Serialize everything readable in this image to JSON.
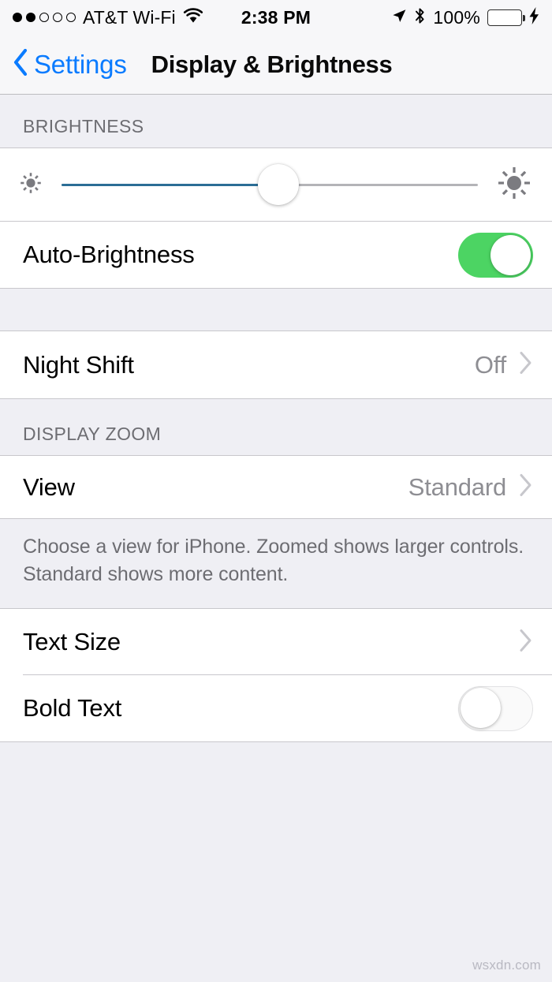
{
  "status_bar": {
    "signal_dots_filled": 2,
    "signal_dots_total": 5,
    "carrier": "AT&T Wi-Fi",
    "wifi_icon": "wifi-icon",
    "time": "2:38 PM",
    "location_icon": "location-arrow-icon",
    "bluetooth_icon": "bluetooth-icon",
    "battery_percent": "100%",
    "battery_level": 100,
    "charging_icon": "lightning-bolt-icon",
    "battery_color": "#4cd964"
  },
  "nav_bar": {
    "back_label": "Settings",
    "back_icon": "chevron-left-icon",
    "title": "Display & Brightness",
    "accent_color": "#0a7bff"
  },
  "sections": {
    "brightness": {
      "header": "BRIGHTNESS",
      "slider": {
        "name": "brightness-slider",
        "value_percent": 52,
        "min_icon": "sun-small-icon",
        "max_icon": "sun-large-icon",
        "fill_color": "#2b6e96",
        "track_color": "#b4b4b8"
      },
      "auto_brightness": {
        "label": "Auto-Brightness",
        "state": "on",
        "on_color": "#4cd463"
      }
    },
    "night_shift": {
      "label": "Night Shift",
      "value": "Off",
      "chevron_icon": "chevron-right-icon"
    },
    "display_zoom": {
      "header": "DISPLAY ZOOM",
      "view": {
        "label": "View",
        "value": "Standard",
        "chevron_icon": "chevron-right-icon"
      },
      "footer": "Choose a view for iPhone. Zoomed shows larger controls. Standard shows more content."
    },
    "text": {
      "text_size": {
        "label": "Text Size",
        "chevron_icon": "chevron-right-icon"
      },
      "bold_text": {
        "label": "Bold Text",
        "state": "off"
      }
    }
  },
  "watermark": "wsxdn.com"
}
